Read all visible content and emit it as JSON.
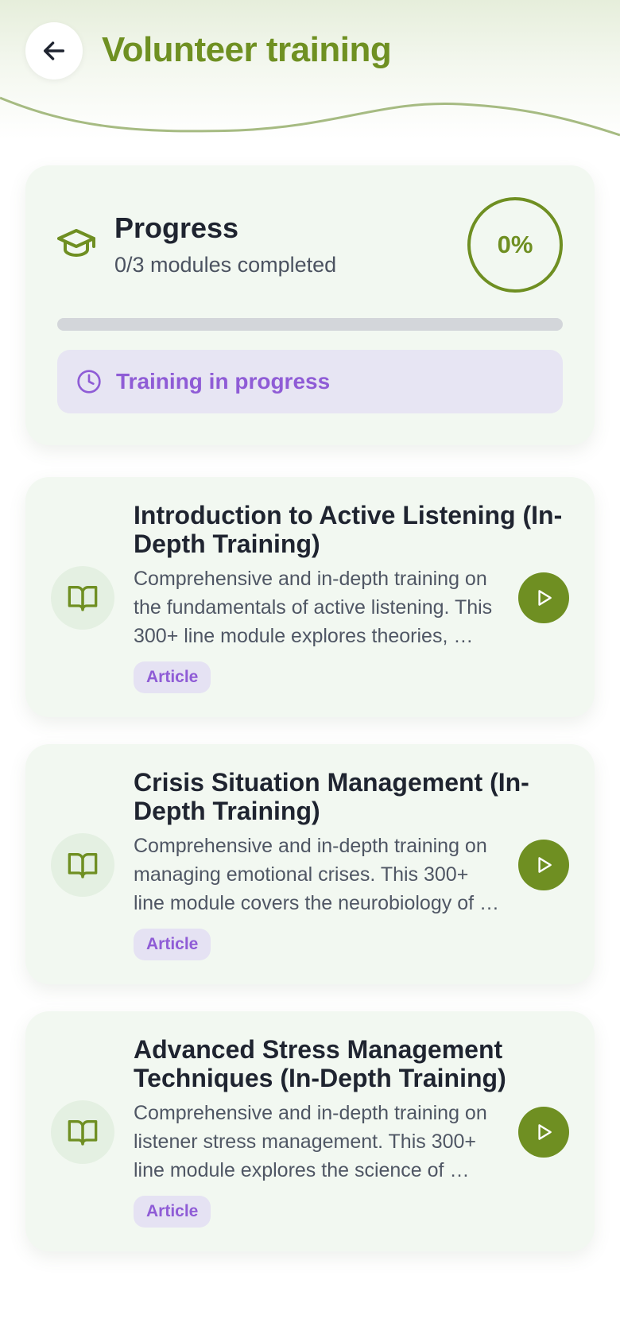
{
  "header": {
    "title": "Volunteer training",
    "back_icon": "arrow-left-icon",
    "accent_color": "#6f9022"
  },
  "progress": {
    "icon": "graduation-cap-icon",
    "title": "Progress",
    "subtitle": "0/3 modules completed",
    "percent_label": "0%",
    "completed_fraction": 0,
    "status_icon": "clock-icon",
    "status_text": "Training in progress"
  },
  "modules": [
    {
      "icon": "book-open-icon",
      "title": "Introduction to Active Listening (In-Depth Training)",
      "description_lines": [
        "Comprehensive and in-depth training on",
        "the fundamentals of active listening. This",
        "300+ line module explores theories, …"
      ],
      "badge": "Article",
      "action_icon": "play-icon"
    },
    {
      "icon": "book-open-icon",
      "title": "Crisis Situation Management (In-Depth Training)",
      "description_lines": [
        "Comprehensive and in-depth training on",
        "managing emotional crises. This 300+",
        "line module covers the neurobiology of …"
      ],
      "badge": "Article",
      "action_icon": "play-icon"
    },
    {
      "icon": "book-open-icon",
      "title": "Advanced Stress Management Techniques (In-Depth Training)",
      "description_lines": [
        "Comprehensive and in-depth training on",
        "listener stress management. This 300+",
        "line module explores the science of …"
      ],
      "badge": "Article",
      "action_icon": "play-icon"
    }
  ],
  "colors": {
    "primary_green": "#6f8f22",
    "status_purple": "#8f5cd6",
    "card_background": "#f2f8f1"
  }
}
